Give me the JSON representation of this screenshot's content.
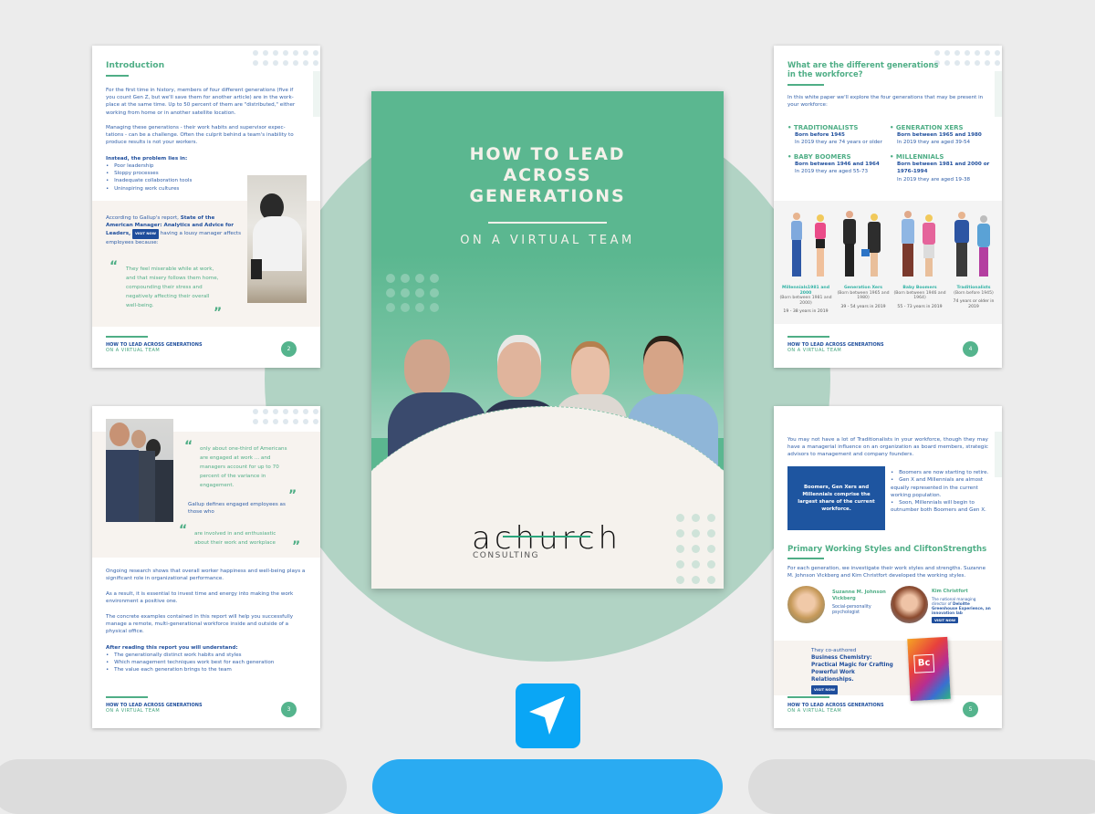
{
  "cover": {
    "title_lines": [
      "HOW TO LEAD",
      "ACROSS",
      "GENERATIONS"
    ],
    "subtitle": "ON A VIRTUAL TEAM",
    "logo_text": "achurch",
    "logo_sub": "CONSULTING",
    "accent": "#5bb790"
  },
  "footer": {
    "line1": "HOW TO LEAD ACROSS GENERATIONS",
    "line2": "ON A VIRTUAL TEAM"
  },
  "visit_label": "VISIT NOW",
  "page2": {
    "title": "Introduction",
    "p1": "For the first time in history, members of four different generations (five if you count Gen Z, but we'll save them for another article) are in the work-place at the same time. Up to 50 percent of them are \"distributed,\" either working from home or in another satellite location.",
    "p2": "Managing these generations -  their work habits and supervisor expec-tations - can be a challenge. Often the culprit behind a team's inability to produce results is not your workers.",
    "list_title": "Instead, the problem lies in:",
    "list": [
      "Poor leadership",
      "Sloppy processes",
      "Inadequate collaboration tools",
      "Uninspiring work cultures"
    ],
    "gallup_pre": "According to Gallup's report, ",
    "gallup_bold": "State of the American Manager: Analytics and Advice for Leaders,",
    "gallup_post": " having a lousy manager affects employees because:",
    "quote": "They feel miserable while at work, and that misery follows them home, compounding their stress and negatively affecting their overall well-being.",
    "page_number": "2"
  },
  "page3": {
    "quote1": "only about one-third of Americans are engaged at work ... and managers account for up to 70 percent of the variance in engagement.",
    "define": "Gallup defines engaged employees as those who",
    "quote2": "are involved in and enthusiastic about their work and workplace",
    "p1": "Ongoing research shows that overall worker happiness and well-being plays a significant role in organizational performance.",
    "p2": "As a result, it is essential to invest time and energy into making the work environment a positive one.",
    "p3": "The concrete examples contained in this report will help you successfully manage a remote, multi-generational workforce inside and outside of a physical office.",
    "list_title": "After reading this report you will understand:",
    "list": [
      "The generationally distinct work habits and styles",
      "Which management techniques work best for each generation",
      "The value each generation brings to the team"
    ],
    "page_number": "3"
  },
  "page4": {
    "title": "What are the different generations in the workforce?",
    "intro": "In this white paper we'll explore the four generations that may be present in your workforce:",
    "generations": [
      {
        "name": "TRADITIONALISTS",
        "born": "Born before 1945",
        "age": "In 2019 they are 74 years or older"
      },
      {
        "name": "GENERATION XERS",
        "born": "Born between 1965 and 1980",
        "age": "In 2019 they are aged 39-54"
      },
      {
        "name": "BABY BOOMERS",
        "born": "Born between 1946 and 1964",
        "age": "In 2019 they are aged 55-73"
      },
      {
        "name": "MILLENNIALS",
        "born": "Born between 1981 and 2000 or 1976-1994",
        "age": "In 2019 they are aged 19-38"
      }
    ],
    "figure_labels": [
      {
        "name": "Millennials1981 and 2000",
        "born": "(Born between 1981 and 2000)",
        "age": "19 - 38 years in 2019"
      },
      {
        "name": "Generation Xers",
        "born": "(Born between 1965 and 1980)",
        "age": "39 - 54 years in 2019"
      },
      {
        "name": "Baby Boomers",
        "born": "(Born between 1946 and 1964)",
        "age": "55 - 73 years in 2019"
      },
      {
        "name": "Traditionalists",
        "born": "(Born before 1945)",
        "age": "74 years or older in 2019"
      }
    ],
    "page_number": "4"
  },
  "page5": {
    "p1": "You may not have a lot of Traditionalists in your workforce, though they may have a managerial influence on an organization as board members, strategic advisors to management and company founders.",
    "box": "Boomers, Gen Xers and Millennials comprise the largest share of the current workforce.",
    "list": [
      "Boomers are now starting to retire.",
      "Gen X and Millennials are almost equally represented in the current working population.",
      "Soon, Millennials will begin to outnumber both Boomers and Gen X."
    ],
    "heading": "Primary Working Styles and CliftonStrengths",
    "p2": "For each generation, we investigate their work styles and strengths. Suzanne M. Johnson Vickberg and Kim Christfort developed the working styles.",
    "person1": {
      "name": "Suzanne M. Johnson Vickberg",
      "role": "Social-personality psychologist"
    },
    "person2": {
      "name": "Kim Christfort",
      "role_pre": "The national managing director of ",
      "role_bold": "Deloitte Greenhouse Experience, an innovation lab"
    },
    "coauth": "They co-authored",
    "book": "Business Chemistry: Practical Magic for Crafting Powerful Work Relationships.",
    "book_cover_text": "Bc",
    "page_number": "5"
  },
  "share_icon": "navigation-arrow-icon",
  "colors": {
    "green": "#4fae86",
    "blue": "#1f4e9c",
    "share": "#0aa6f5"
  }
}
